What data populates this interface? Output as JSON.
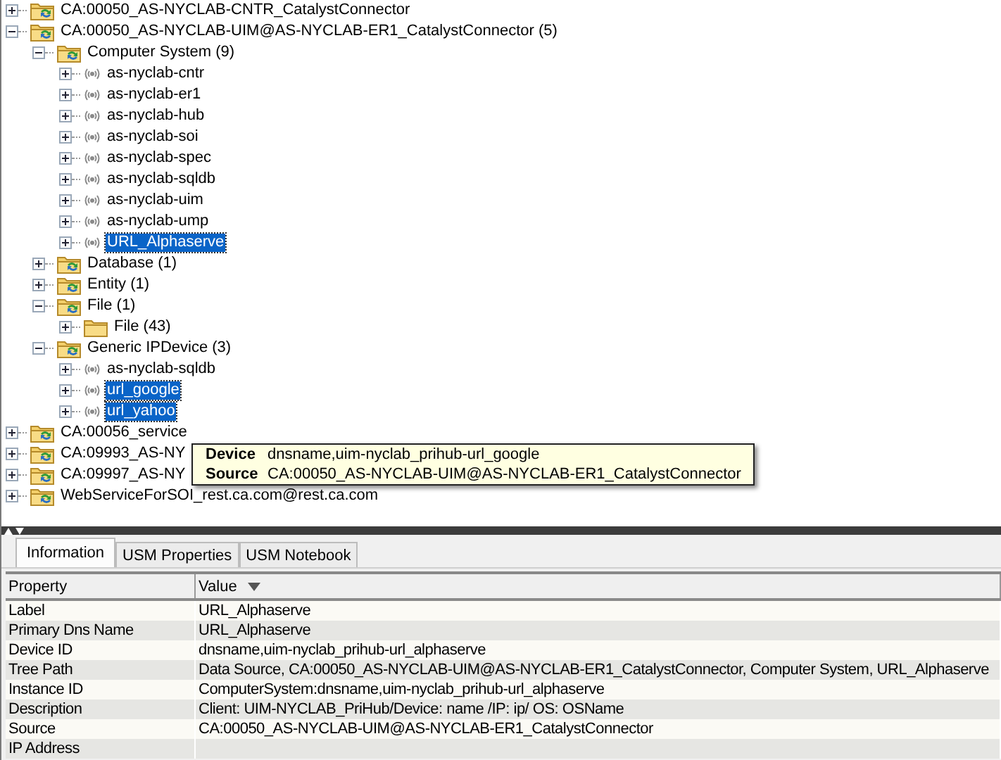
{
  "tree": [
    {
      "label": "CA:00050_AS-NYCLAB-CNTR_CatalystConnector",
      "kind": "source",
      "expanded": false,
      "selected": false
    },
    {
      "label": "CA:00050_AS-NYCLAB-UIM@AS-NYCLAB-ER1_CatalystConnector (5)",
      "kind": "source",
      "expanded": true,
      "selected": false,
      "children": [
        {
          "label": "Computer System (9)",
          "kind": "source",
          "expanded": true,
          "selected": false,
          "children": [
            {
              "label": "as-nyclab-cntr",
              "kind": "device",
              "expanded": false,
              "selected": false
            },
            {
              "label": "as-nyclab-er1",
              "kind": "device",
              "expanded": false,
              "selected": false
            },
            {
              "label": "as-nyclab-hub",
              "kind": "device",
              "expanded": false,
              "selected": false
            },
            {
              "label": "as-nyclab-soi",
              "kind": "device",
              "expanded": false,
              "selected": false
            },
            {
              "label": "as-nyclab-spec",
              "kind": "device",
              "expanded": false,
              "selected": false
            },
            {
              "label": "as-nyclab-sqldb",
              "kind": "device",
              "expanded": false,
              "selected": false
            },
            {
              "label": "as-nyclab-uim",
              "kind": "device",
              "expanded": false,
              "selected": false
            },
            {
              "label": "as-nyclab-ump",
              "kind": "device",
              "expanded": false,
              "selected": false
            },
            {
              "label": "URL_Alphaserve",
              "kind": "device",
              "expanded": false,
              "selected": true
            }
          ]
        },
        {
          "label": "Database (1)",
          "kind": "source",
          "expanded": false,
          "selected": false
        },
        {
          "label": "Entity (1)",
          "kind": "source",
          "expanded": false,
          "selected": false
        },
        {
          "label": "File (1)",
          "kind": "source",
          "expanded": true,
          "selected": false,
          "children": [
            {
              "label": "File (43)",
              "kind": "folder",
              "expanded": false,
              "selected": false
            }
          ]
        },
        {
          "label": "Generic IPDevice (3)",
          "kind": "source",
          "expanded": true,
          "selected": false,
          "children": [
            {
              "label": "as-nyclab-sqldb",
              "kind": "device",
              "expanded": false,
              "selected": false
            },
            {
              "label": "url_google",
              "kind": "device",
              "expanded": false,
              "selected": true
            },
            {
              "label": "url_yahoo",
              "kind": "device",
              "expanded": false,
              "selected": true
            }
          ]
        }
      ]
    },
    {
      "label": "CA:00056_service",
      "kind": "source",
      "expanded": false,
      "selected": false
    },
    {
      "label": "CA:09993_AS-NY",
      "kind": "source",
      "expanded": false,
      "selected": false
    },
    {
      "label": "CA:09997_AS-NY",
      "kind": "source",
      "expanded": false,
      "selected": false
    },
    {
      "label": "WebServiceForSOI_rest.ca.com@rest.ca.com",
      "kind": "source",
      "expanded": false,
      "selected": false
    }
  ],
  "tooltip": {
    "rows": [
      {
        "label": "Device",
        "value": "dnsname,uim-nyclab_prihub-url_google"
      },
      {
        "label": "Source",
        "value": "CA:00050_AS-NYCLAB-UIM@AS-NYCLAB-ER1_CatalystConnector"
      }
    ]
  },
  "tabs": [
    {
      "label": "Information",
      "selected": true
    },
    {
      "label": "USM Properties",
      "selected": false
    },
    {
      "label": "USM Notebook",
      "selected": false
    }
  ],
  "table": {
    "columns": [
      "Property",
      "Value"
    ],
    "rows": [
      [
        "Label",
        "URL_Alphaserve"
      ],
      [
        "Primary Dns Name",
        "URL_Alphaserve"
      ],
      [
        "Device ID",
        "dnsname,uim-nyclab_prihub-url_alphaserve"
      ],
      [
        "Tree Path",
        "Data Source, CA:00050_AS-NYCLAB-UIM@AS-NYCLAB-ER1_CatalystConnector, Computer System, URL_Alphaserve"
      ],
      [
        "Instance ID",
        "ComputerSystem:dnsname,uim-nyclab_prihub-url_alphaserve"
      ],
      [
        "Description",
        "Client: UIM-NYCLAB_PriHub/Device: name /IP: ip/ OS: OSName"
      ],
      [
        "Source",
        "CA:00050_AS-NYCLAB-UIM@AS-NYCLAB-ER1_CatalystConnector"
      ],
      [
        "IP Address",
        ""
      ]
    ]
  }
}
